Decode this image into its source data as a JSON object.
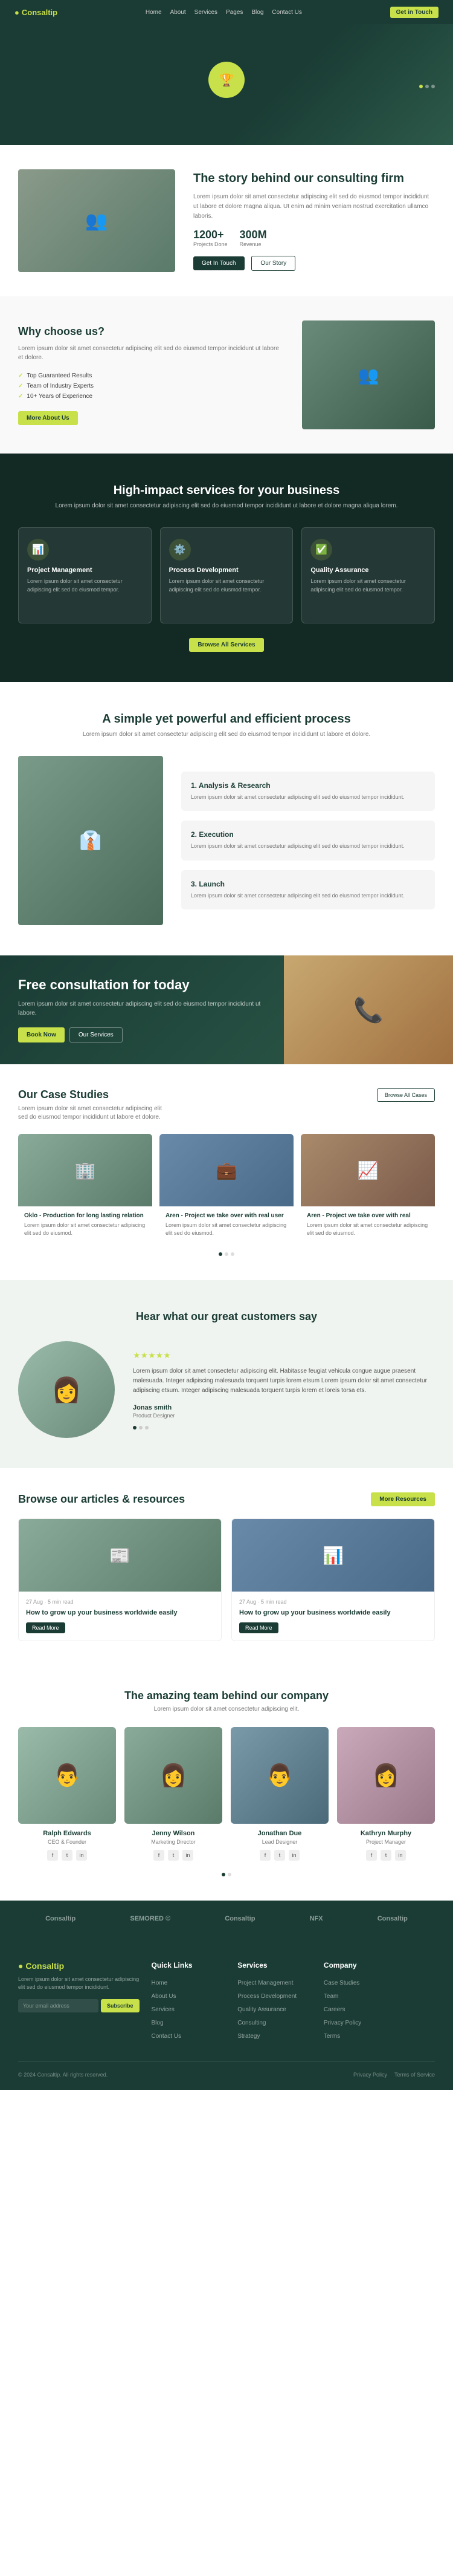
{
  "nav": {
    "logo": "Consaltip",
    "logo_dot": "●",
    "links": [
      "Home",
      "About",
      "Services",
      "Pages",
      "Blog",
      "Contact Us"
    ],
    "cta": "Get in Touch"
  },
  "hero": {
    "badge_icon": "🏆",
    "dots": [
      true,
      false,
      false
    ]
  },
  "story": {
    "heading": "The story behind our consulting firm",
    "desc": "Lorem ipsum dolor sit amet consectetur adipiscing elit sed do eiusmod tempor incididunt ut labore et dolore magna aliqua. Ut enim ad minim veniam nostrud exercitation ullamco laboris.",
    "stat1_num": "1200+",
    "stat1_label": "Projects Done",
    "stat2_num": "300M",
    "stat2_label": "Revenue",
    "btn1": "Get In Touch",
    "btn2": "Our Story"
  },
  "why": {
    "heading": "Why choose us?",
    "desc": "Lorem ipsum dolor sit amet consectetur adipiscing elit sed do eiusmod tempor incididunt ut labore et dolore.",
    "list": [
      "Top Guaranteed Results",
      "Team of Industry Experts",
      "10+ Years of Experience"
    ],
    "btn": "More About Us"
  },
  "services": {
    "heading": "High-impact services for your business",
    "desc": "Lorem ipsum dolor sit amet consectetur adipiscing elit sed do eiusmod tempor incididunt ut labore et dolore magna aliqua lorem.",
    "cards": [
      {
        "icon": "📊",
        "title": "Project Management",
        "desc": "Lorem ipsum dolor sit amet consectetur adipiscing elit sed do eiusmod tempor."
      },
      {
        "icon": "⚙️",
        "title": "Process Development",
        "desc": "Lorem ipsum dolor sit amet consectetur adipiscing elit sed do eiusmod tempor."
      },
      {
        "icon": "✅",
        "title": "Quality Assurance",
        "desc": "Lorem ipsum dolor sit amet consectetur adipiscing elit sed do eiusmod tempor."
      }
    ],
    "btn": "Browse All Services"
  },
  "process": {
    "heading": "A simple yet powerful and efficient process",
    "desc": "Lorem ipsum dolor sit amet consectetur adipiscing elit sed do eiusmod tempor incididunt ut labore et dolore.",
    "steps": [
      {
        "title": "1. Analysis & Research",
        "desc": "Lorem ipsum dolor sit amet consectetur adipiscing elit sed do eiusmod tempor incididunt."
      },
      {
        "title": "2. Execution",
        "desc": "Lorem ipsum dolor sit amet consectetur adipiscing elit sed do eiusmod tempor incididunt."
      },
      {
        "title": "3. Launch",
        "desc": "Lorem ipsum dolor sit amet consectetur adipiscing elit sed do eiusmod tempor incididunt."
      }
    ]
  },
  "consult": {
    "heading": "Free consultation for today",
    "desc": "Lorem ipsum dolor sit amet consectetur adipiscing elit sed do eiusmod tempor incididunt ut labore.",
    "btn1": "Book Now",
    "btn2": "Our Services"
  },
  "cases": {
    "heading": "Our Case Studies",
    "desc": "Lorem ipsum dolor sit amet consectetur adipiscing elit sed do eiusmod tempor incididunt ut labore et dolore.",
    "btn": "Browse All Cases",
    "cards": [
      {
        "title": "Oklo - Production for long lasting relation",
        "desc": "Lorem ipsum dolor sit amet consectetur adipiscing elit sed do eiusmod."
      },
      {
        "title": "Aren - Project we take over with real user",
        "desc": "Lorem ipsum dolor sit amet consectetur adipiscing elit sed do eiusmod."
      },
      {
        "title": "Aren - Project we take over with real",
        "desc": "Lorem ipsum dolor sit amet consectetur adipiscing elit sed do eiusmod."
      }
    ]
  },
  "testimonials": {
    "heading": "Hear what our great customers say",
    "stars": "★★★★★",
    "quote": "Lorem ipsum dolor sit amet consectetur adipiscing elit. Habitasse feugiat vehicula congue augue praesent malesuada. Integer adipiscing malesuada torquent turpis lorem etsum Lorem ipsum dolor sit amet consectetur adipiscing etsum. Integer adipiscing malesuada torquent turpis lorem et loreis torsa ets.",
    "author": "Jonas smith",
    "author_title": "Product Designer"
  },
  "articles": {
    "heading": "Browse our articles & resources",
    "btn": "More Resources",
    "cards": [
      {
        "meta": "27 Aug · 5 min read",
        "title": "How to grow up your business worldwide easily",
        "btn": "Read More"
      },
      {
        "meta": "27 Aug · 5 min read",
        "title": "How to grow up your business worldwide easily",
        "btn": "Read More"
      }
    ]
  },
  "team": {
    "heading": "The amazing team behind our company",
    "subtitle": "Lorem ipsum dolor sit amet consectetur adipiscing elit.",
    "members": [
      {
        "name": "Ralph Edwards",
        "role": "CEO & Founder"
      },
      {
        "name": "Jenny Wilson",
        "role": "Marketing Director"
      },
      {
        "name": "Jonathan Due",
        "role": "Lead Designer"
      },
      {
        "name": "Kathryn Murphy",
        "role": "Project Manager"
      }
    ],
    "social": [
      "f",
      "t",
      "in"
    ]
  },
  "partners": [
    "Consaltip",
    "SEMORED ©",
    "Consaltip",
    "NFX",
    "Consaltip"
  ],
  "footer": {
    "logo": "Consaltip",
    "desc": "Lorem ipsum dolor sit amet consectetur adipiscing elit sed do eiusmod tempor incididunt.",
    "newsletter_placeholder": "Your email address",
    "newsletter_btn": "Subscribe",
    "cols": [
      {
        "title": "Quick Links",
        "links": [
          "Home",
          "About Us",
          "Services",
          "Blog",
          "Contact Us"
        ]
      },
      {
        "title": "Services",
        "links": [
          "Project Management",
          "Process Development",
          "Quality Assurance",
          "Consulting",
          "Strategy"
        ]
      },
      {
        "title": "Company",
        "links": [
          "Case Studies",
          "Team",
          "Careers",
          "Privacy Policy",
          "Terms"
        ]
      }
    ],
    "copyright": "© 2024 Consaltip. All rights reserved.",
    "footer_links": [
      "Privacy Policy",
      "Terms of Service"
    ]
  }
}
